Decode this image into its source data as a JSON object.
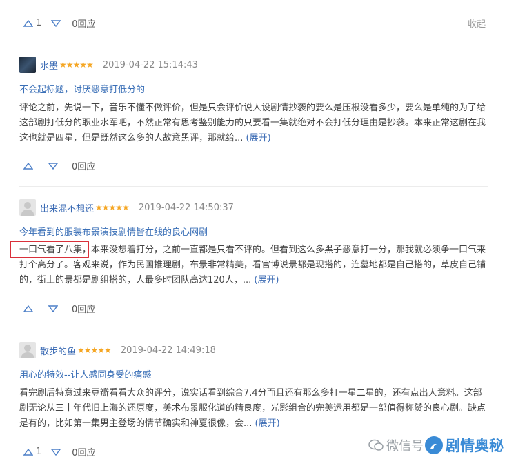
{
  "top": {
    "up_count": "1",
    "reply": "0回应",
    "collapse": "收起"
  },
  "reviews": [
    {
      "username": "水墨",
      "stars": "★★★★★",
      "date": "2019-04-22 15:14:43",
      "title": "不会起标题，讨厌恶意打低分的",
      "body": "评论之前，先说一下，音乐不懂不做评价，但是只会评价说人设剧情抄袭的要么是压根没看多少，要么是单纯的为了给这部剧打低分的职业水军吧，不然正常有思考鉴别能力的只要看一集就绝对不会打低分理由是抄袭。本来正常这剧在我这也就是四星，但是既然这么多的人故意黑评，那就给...",
      "expand": "(展开)",
      "up_count": "",
      "reply": "0回应"
    },
    {
      "username": "出来混不想还",
      "stars": "★★★★★",
      "date": "2019-04-22 14:50:37",
      "title": "今年看到的服装布景演技剧情皆在线的良心网剧",
      "body": "一口气看了八集，本来没想着打分，之前一直都是只看不评的。但看到这么多黑子恶意打一分，那我就必须争一口气来打个高分了。客观来说，作为民国推理剧，布景非常精美，看官博说景都是现搭的，连墓地都是自己搭的，草皮自己铺的，街上的景都是剧组搭的，人最多时团队高达120人，...",
      "expand": "(展开)",
      "up_count": "",
      "reply": "0回应"
    },
    {
      "username": "散步的鱼",
      "stars": "★★★★★",
      "date": "2019-04-22 14:49:18",
      "title": "用心的特效--让人感同身受的痛感",
      "body": "看完剧后特意过来豆瓣看看大众的评分，说实话看到综合7.4分而且还有那么多打一星二星的，还有点出人意料。这部剧无论从三十年代旧上海的还原度，美术布景服化道的精良度，光影组合的完美运用都是一部值得称赞的良心剧。缺点是有的，比如第一集男主登场的情节确实和神夏很像，会...",
      "expand": "(展开)",
      "up_count": "1",
      "reply": "0回应"
    }
  ],
  "watermark": {
    "wechat": "微信号",
    "brand": "剧情奥秘"
  }
}
